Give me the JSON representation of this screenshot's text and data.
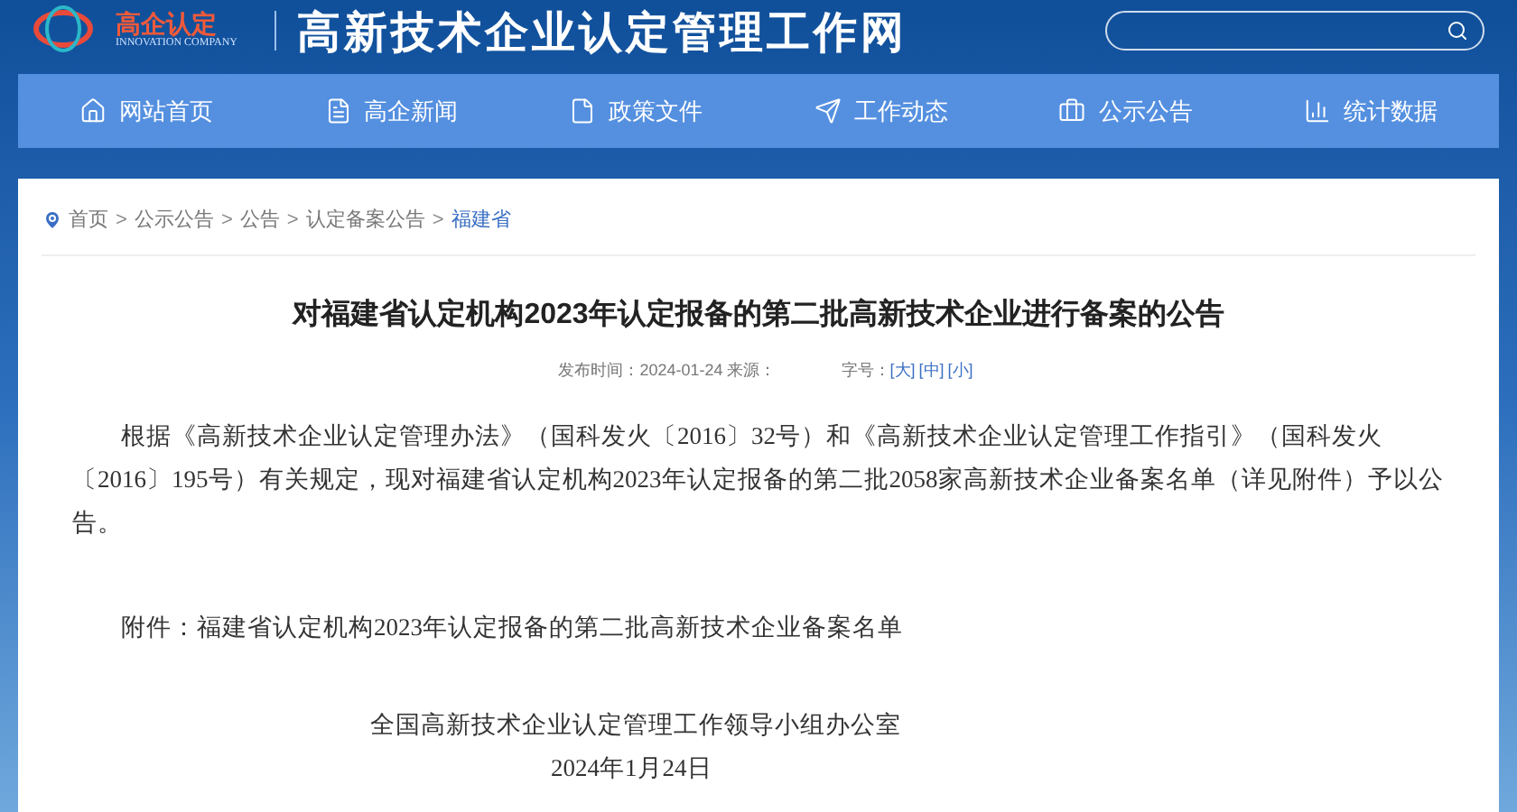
{
  "header": {
    "logo_text": "高企认定",
    "logo_subtext": "INNOVATION COMPANY",
    "site_title": "高新技术企业认定管理工作网"
  },
  "nav": [
    {
      "label": "网站首页"
    },
    {
      "label": "高企新闻"
    },
    {
      "label": "政策文件"
    },
    {
      "label": "工作动态"
    },
    {
      "label": "公示公告"
    },
    {
      "label": "统计数据"
    }
  ],
  "breadcrumb": [
    {
      "label": "首页",
      "current": false
    },
    {
      "separator": ">",
      "label": "公示公告",
      "current": false
    },
    {
      "separator": ">",
      "label": "公告",
      "current": false
    },
    {
      "separator": ">",
      "label": "认定备案公告",
      "current": false
    },
    {
      "separator": ">",
      "label": "福建省",
      "current": true
    }
  ],
  "article": {
    "title": "对福建省认定机构2023年认定报备的第二批高新技术企业进行备案的公告",
    "meta": {
      "published": "发布时间：2024-01-24 来源：",
      "font_size_label": "字号：",
      "font_sizes": [
        "[大]",
        "[中]",
        "[小]"
      ]
    },
    "paragraphs": [
      "根据《高新技术企业认定管理办法》（国科发火〔2016〕32号）和《高新技术企业认定管理工作指引》（国科发火〔2016〕195号）有关规定，现对福建省认定机构2023年认定报备的第二批2058家高新技术企业备案名单（详见附件）予以公告。",
      "附件：福建省认定机构2023年认定报备的第二批高新技术企业备案名单"
    ],
    "signature": "全国高新技术企业认定管理工作领导小组办公室",
    "date": "2024年1月24日"
  }
}
